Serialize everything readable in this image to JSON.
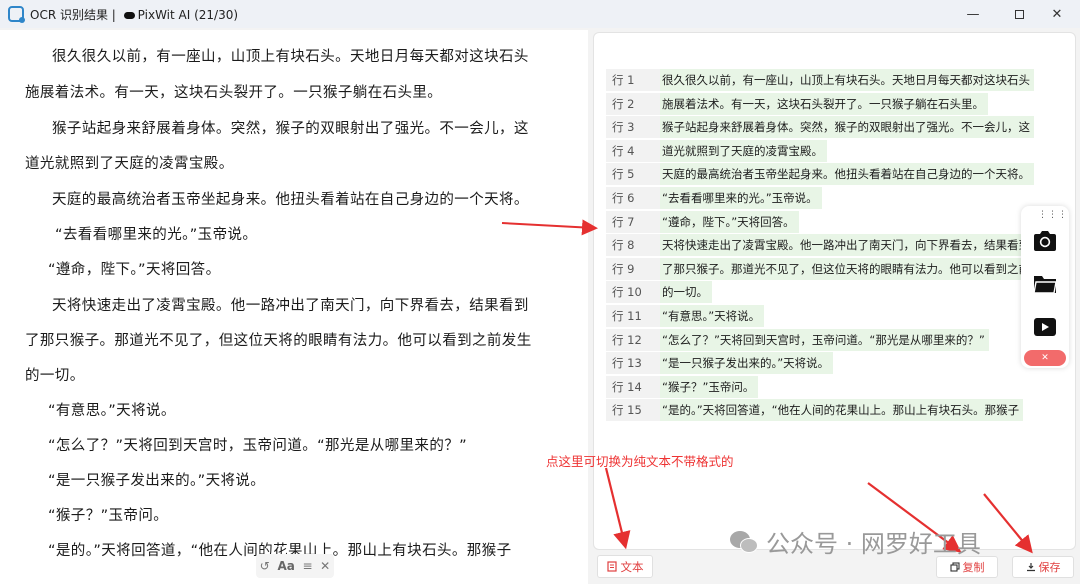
{
  "window": {
    "title": "OCR 识别结果 | ",
    "app_name": "PixWit AI (21/30)",
    "min_glyph": "—",
    "close_glyph": "✕"
  },
  "left_pane": {
    "lines": [
      "很久很久以前，有一座山，山顶上有块石头。天地日月每天都对这块石头",
      "施展着法术。有一天，这块石头裂开了。一只猴子躺在石头里。",
      "猴子站起身来舒展着身体。突然，猴子的双眼射出了强光。不一会儿，这",
      "道光就照到了天庭的凌霄宝殿。",
      "天庭的最高统治者玉帝坐起身来。他扭头看着站在自己身边的一个天将。",
      "“去看看哪里来的光。”玉帝说。",
      "“遵命，陛下。”天将回答。",
      "天将快速走出了凌霄宝殿。他一路冲出了南天门，向下界看去，结果看到",
      "了那只猴子。那道光不见了，但这位天将的眼睛有法力。他可以看到之前发生",
      "的一切。",
      "“有意思。”天将说。",
      "“怎么了？”天将回到天宫时，玉帝问道。“那光是从哪里来的？”",
      "“是一只猴子发出来的。”天将说。",
      "“猴子？”玉帝问。",
      "“是的。”天将回答道，“他在人间的花果山上。那山上有块石头。那猴子"
    ],
    "toolbar": {
      "reset_glyph": "↺",
      "font_label": "Aa",
      "font_size_glyph": "≡",
      "close_glyph": "✕"
    }
  },
  "right_pane": {
    "rows": [
      {
        "num": "行 1",
        "text": "很久很久以前，有一座山，山顶上有块石头。天地日月每天都对这块石头"
      },
      {
        "num": "行 2",
        "text": "施展着法术。有一天，这块石头裂开了。一只猴子躺在石头里。"
      },
      {
        "num": "行 3",
        "text": "猴子站起身来舒展着身体。突然，猴子的双眼射出了强光。不一会儿，这"
      },
      {
        "num": "行 4",
        "text": "道光就照到了天庭的凌霄宝殿。"
      },
      {
        "num": "行 5",
        "text": "天庭的最高统治者玉帝坐起身来。他扭头看着站在自己身边的一个天将。"
      },
      {
        "num": "行 6",
        "text": "“去看看哪里来的光。”玉帝说。"
      },
      {
        "num": "行 7",
        "text": "“遵命，陛下。”天将回答。"
      },
      {
        "num": "行 8",
        "text": "天将快速走出了凌霄宝殿。他一路冲出了南天门，向下界看去，结果看到"
      },
      {
        "num": "行 9",
        "text": "了那只猴子。那道光不见了，但这位天将的眼睛有法力。他可以看到之前发生"
      },
      {
        "num": "行 10",
        "text": "的一切。"
      },
      {
        "num": "行 11",
        "text": "“有意思。”天将说。"
      },
      {
        "num": "行 12",
        "text": "“怎么了？”天将回到天宫时，玉帝问道。“那光是从哪里来的？”"
      },
      {
        "num": "行 13",
        "text": "“是一只猴子发出来的。”天将说。"
      },
      {
        "num": "行 14",
        "text": "“猴子？”玉帝问。"
      },
      {
        "num": "行 15",
        "text": "“是的。”天将回答道，“他在人间的花果山上。那山上有块石头。那猴子"
      }
    ]
  },
  "float_toolbar": {
    "handle": "⋮⋮⋮",
    "close_glyph": "✕",
    "icons": [
      "camera-icon",
      "folder-icon",
      "video-icon"
    ]
  },
  "buttons": {
    "text_mode": "文本",
    "copy": "复制",
    "save": "保存"
  },
  "annotation": "点这里可切换为纯文本不带格式的",
  "watermark": "公众号 · 网罗好工具",
  "colors": {
    "accent_red": "#e04040",
    "line_highlight": "#e8f5e6",
    "close_pill": "#f26b6b"
  }
}
